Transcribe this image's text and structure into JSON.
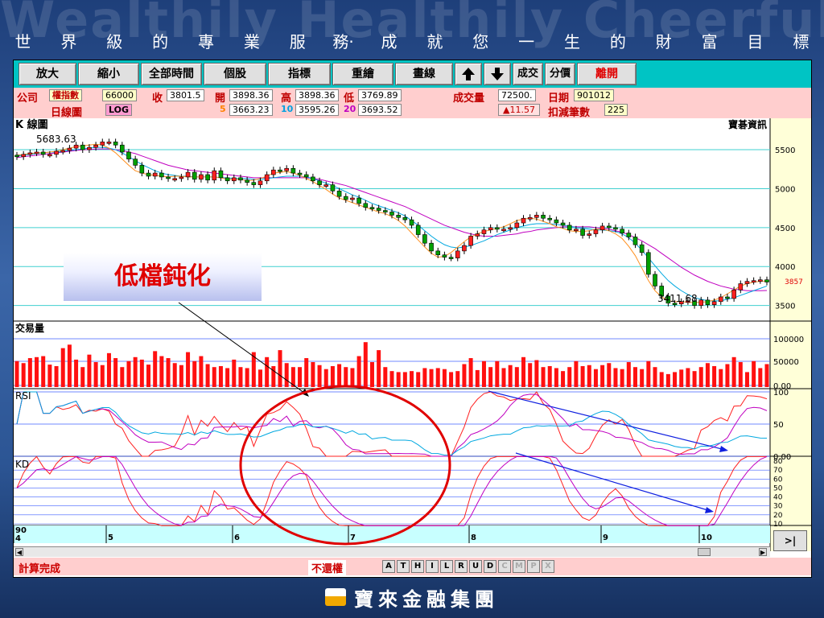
{
  "watermark": "Wealthily Healthily Cheerfully",
  "slogan": [
    "世",
    "界",
    "級",
    "的",
    "專",
    "業",
    "服",
    "務·",
    "成",
    "就",
    "您",
    "一",
    "生",
    "的",
    "財",
    "富",
    "目",
    "標"
  ],
  "toolbar": {
    "buttons": [
      "放大",
      "縮小",
      "全部時間",
      "個股",
      "指標",
      "重繪",
      "畫線",
      "成交",
      "分價",
      "離開"
    ]
  },
  "info": {
    "company_label": "公司",
    "stock_name": "權指數",
    "stock_code": "66000",
    "close_label": "收",
    "close": "3801.5",
    "open_label": "開",
    "open": "3898.36",
    "high_label": "高",
    "high": "3898.36",
    "low_label": "低",
    "low": "3769.89",
    "volume_label": "成交量",
    "volume": "72500.",
    "date_label": "日期",
    "date": "901012",
    "period": "日線圖",
    "log_btn": "LOG",
    "ma5_label": "5",
    "ma5": "3663.23",
    "ma10_label": "10",
    "ma10": "3595.26",
    "ma20_label": "20",
    "ma20": "3693.52",
    "change": "▲11.57",
    "deduct_label": "扣減筆數",
    "deduct": "225"
  },
  "chart_data": {
    "type": "line",
    "title": "K 線圖",
    "source": "寶碁資訊",
    "y_ticks": [
      "5500",
      "5000",
      "4500",
      "4000",
      "3500"
    ],
    "last_value": "3857",
    "high_annotation": "5683.63",
    "low_annotation": "3411.68",
    "close": [
      5410,
      5440,
      5460,
      5470,
      5440,
      5440,
      5480,
      5490,
      5520,
      5560,
      5500,
      5530,
      5560,
      5600,
      5600,
      5560,
      5470,
      5380,
      5300,
      5200,
      5160,
      5200,
      5150,
      5130,
      5130,
      5150,
      5210,
      5120,
      5180,
      5110,
      5230,
      5140,
      5100,
      5140,
      5110,
      5080,
      5050,
      5100,
      5180,
      5240,
      5230,
      5260,
      5200,
      5180,
      5150,
      5100,
      5050,
      5050,
      4970,
      4900,
      4860,
      4880,
      4810,
      4760,
      4750,
      4720,
      4700,
      4660,
      4630,
      4600,
      4530,
      4410,
      4300,
      4200,
      4150,
      4120,
      4110,
      4200,
      4270,
      4390,
      4420,
      4470,
      4500,
      4480,
      4480,
      4500,
      4560,
      4620,
      4630,
      4660,
      4620,
      4600,
      4560,
      4530,
      4470,
      4480,
      4400,
      4420,
      4470,
      4520,
      4500,
      4480,
      4430,
      4380,
      4280,
      4180,
      3900,
      3750,
      3620,
      3530,
      3520,
      3550,
      3560,
      3500,
      3570,
      3510,
      3550,
      3610,
      3590,
      3700,
      3780,
      3810,
      3820,
      3830,
      3801
    ],
    "ma5": [
      5430,
      5440,
      5450,
      5460,
      5460,
      5470,
      5480,
      5500,
      5520,
      5540,
      5550,
      5560,
      5570,
      5560,
      5520,
      5460,
      5380,
      5300,
      5230,
      5200,
      5180,
      5170,
      5160,
      5150,
      5160,
      5160,
      5150,
      5150,
      5150,
      5150,
      5150,
      5140,
      5120,
      5120,
      5120,
      5100,
      5110,
      5130,
      5160,
      5200,
      5210,
      5220,
      5200,
      5170,
      5130,
      5090,
      5040,
      4990,
      4930,
      4880,
      4850,
      4820,
      4790,
      4760,
      4730,
      4700,
      4680,
      4640,
      4590,
      4520,
      4430,
      4340,
      4250,
      4170,
      4120,
      4130,
      4180,
      4250,
      4320,
      4380,
      4420,
      4450,
      4470,
      4490,
      4510,
      4550,
      4590,
      4610,
      4620,
      4610,
      4580,
      4550,
      4510,
      4490,
      4460,
      4450,
      4450,
      4460,
      4480,
      4480,
      4460,
      4420,
      4360,
      4260,
      4140,
      3980,
      3820,
      3690,
      3610,
      3560,
      3550,
      3550,
      3540,
      3540,
      3540,
      3550,
      3570,
      3600,
      3650,
      3700,
      3750,
      3780,
      3800,
      3810,
      3815
    ],
    "ma10": [
      5420,
      5430,
      5440,
      5450,
      5460,
      5470,
      5470,
      5480,
      5490,
      5500,
      5510,
      5520,
      5530,
      5530,
      5520,
      5500,
      5460,
      5410,
      5360,
      5310,
      5270,
      5230,
      5200,
      5180,
      5170,
      5160,
      5160,
      5150,
      5150,
      5150,
      5150,
      5140,
      5140,
      5130,
      5130,
      5130,
      5120,
      5120,
      5130,
      5140,
      5150,
      5160,
      5160,
      5160,
      5150,
      5130,
      5100,
      5070,
      5040,
      5000,
      4960,
      4920,
      4890,
      4850,
      4810,
      4780,
      4750,
      4720,
      4690,
      4650,
      4590,
      4530,
      4460,
      4390,
      4330,
      4280,
      4250,
      4240,
      4250,
      4270,
      4300,
      4330,
      4370,
      4410,
      4440,
      4470,
      4500,
      4520,
      4540,
      4550,
      4550,
      4550,
      4540,
      4530,
      4520,
      4500,
      4490,
      4480,
      4470,
      4470,
      4460,
      4450,
      4420,
      4370,
      4300,
      4210,
      4110,
      4010,
      3910,
      3820,
      3750,
      3690,
      3640,
      3600,
      3580,
      3560,
      3560,
      3560,
      3580,
      3600,
      3630,
      3660,
      3690,
      3720,
      3750
    ],
    "ma20": [
      5400,
      5410,
      5420,
      5430,
      5440,
      5450,
      5460,
      5470,
      5480,
      5490,
      5500,
      5500,
      5510,
      5510,
      5510,
      5500,
      5490,
      5470,
      5450,
      5420,
      5390,
      5360,
      5330,
      5300,
      5280,
      5260,
      5240,
      5230,
      5220,
      5210,
      5200,
      5190,
      5180,
      5170,
      5160,
      5150,
      5140,
      5140,
      5140,
      5140,
      5140,
      5140,
      5140,
      5140,
      5140,
      5130,
      5120,
      5100,
      5080,
      5060,
      5040,
      5010,
      4980,
      4950,
      4920,
      4890,
      4860,
      4830,
      4800,
      4770,
      4730,
      4690,
      4650,
      4610,
      4570,
      4530,
      4500,
      4470,
      4440,
      4420,
      4400,
      4390,
      4390,
      4390,
      4400,
      4410,
      4420,
      4440,
      4450,
      4470,
      4480,
      4490,
      4500,
      4510,
      4510,
      4510,
      4510,
      4510,
      4500,
      4490,
      4480,
      4460,
      4440,
      4410,
      4370,
      4330,
      4280,
      4230,
      4170,
      4110,
      4050,
      3990,
      3940,
      3890,
      3850,
      3810,
      3780,
      3750,
      3730,
      3710,
      3700,
      3690,
      3690,
      3690,
      3693
    ],
    "volume_title": "交易量",
    "volume_ticks": [
      "100000",
      "50000",
      "0.00"
    ],
    "volume": [
      52,
      48,
      58,
      60,
      62,
      45,
      42,
      78,
      85,
      55,
      40,
      65,
      50,
      44,
      68,
      58,
      40,
      52,
      60,
      55,
      45,
      72,
      62,
      58,
      48,
      44,
      70,
      52,
      62,
      46,
      40,
      42,
      38,
      55,
      40,
      38,
      70,
      35,
      60,
      42,
      74,
      48,
      40,
      40,
      58,
      50,
      44,
      36,
      42,
      46,
      40,
      38,
      62,
      90,
      50,
      74,
      40,
      32,
      30,
      30,
      32,
      30,
      38,
      36,
      38,
      36,
      30,
      32,
      46,
      58,
      34,
      52,
      40,
      52,
      38,
      44,
      40,
      60,
      48,
      54,
      40,
      42,
      38,
      32,
      40,
      52,
      42,
      44,
      36,
      44,
      48,
      38,
      36,
      50,
      40,
      36,
      52,
      40,
      30,
      26,
      30,
      35,
      38,
      32,
      40,
      48,
      42,
      36,
      46,
      60,
      50,
      30,
      52,
      38,
      46
    ],
    "rsi_title": "RSI",
    "rsi_ticks": [
      "100",
      "50",
      "0.00"
    ],
    "kd_title": "KD",
    "kd_ticks": [
      "80",
      "70",
      "60",
      "50",
      "40",
      "30",
      "20",
      "10"
    ],
    "x_ticks": [
      "90\n4",
      "5",
      "6",
      "7",
      "8",
      "9",
      "10"
    ]
  },
  "annotation": {
    "callout": "低檔鈍化"
  },
  "status": {
    "message": "計算完成",
    "adjust": "不還權",
    "buttons": [
      "A",
      "T",
      "H",
      "I",
      "L",
      "R",
      "U",
      "D",
      "C",
      "M",
      "P",
      "X"
    ]
  },
  "nav_button": ">|",
  "footer": {
    "brand": "寶來金融集團"
  }
}
